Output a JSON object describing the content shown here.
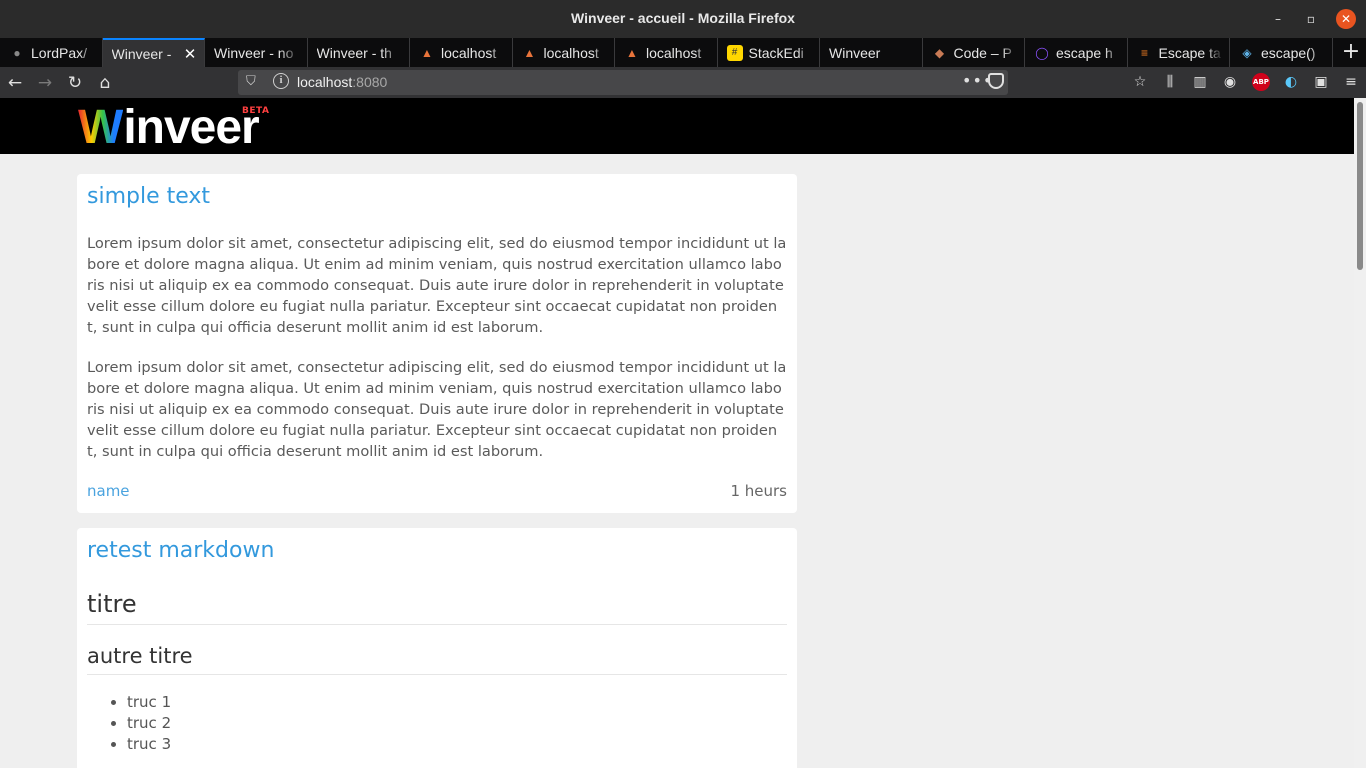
{
  "window": {
    "title": "Winveer - accueil - Mozilla Firefox",
    "minimize": "–",
    "maximize": "▫",
    "close": "✕"
  },
  "tabs": [
    {
      "label": "LordPax/",
      "icon": "github-icon",
      "active": false
    },
    {
      "label": "Winveer - ",
      "icon": "none",
      "active": true
    },
    {
      "label": "Winveer - no",
      "icon": "none",
      "active": false
    },
    {
      "label": "Winveer - th",
      "icon": "none",
      "active": false
    },
    {
      "label": "localhost",
      "icon": "vuepress-icon",
      "active": false
    },
    {
      "label": "localhost",
      "icon": "vuepress-icon",
      "active": false
    },
    {
      "label": "localhost",
      "icon": "vuepress-icon",
      "active": false
    },
    {
      "label": "StackEdi",
      "icon": "stackedit-icon",
      "active": false
    },
    {
      "label": "Winveer",
      "icon": "none",
      "active": false
    },
    {
      "label": "Code – P",
      "icon": "codepen-icon",
      "active": false
    },
    {
      "label": "escape h",
      "icon": "search-icon",
      "active": false
    },
    {
      "label": "Escape ta",
      "icon": "stackoverflow-icon",
      "active": false
    },
    {
      "label": "escape()",
      "icon": "docs-icon",
      "active": false
    }
  ],
  "navbar": {
    "url_host": "localhost",
    "url_port": ":8080",
    "more": "•••"
  },
  "site": {
    "logo_w": "W",
    "logo_rest": "inveer",
    "logo_beta": "BETA"
  },
  "posts": [
    {
      "title": "simple text",
      "paragraphs": [
        "Lorem ipsum dolor sit amet, consectetur adipiscing elit, sed do eiusmod tempor incididunt ut labore et dolore magna aliqua. Ut enim ad minim veniam, quis nostrud exercitation ullamco laboris nisi ut aliquip ex ea commodo consequat. Duis aute irure dolor in reprehenderit in voluptate velit esse cillum dolore eu fugiat nulla pariatur. Excepteur sint occaecat cupidatat non proident, sunt in culpa qui officia deserunt mollit anim id est laborum.",
        "Lorem ipsum dolor sit amet, consectetur adipiscing elit, sed do eiusmod tempor incididunt ut labore et dolore magna aliqua. Ut enim ad minim veniam, quis nostrud exercitation ullamco laboris nisi ut aliquip ex ea commodo consequat. Duis aute irure dolor in reprehenderit in voluptate velit esse cillum dolore eu fugiat nulla pariatur. Excepteur sint occaecat cupidatat non proident, sunt in culpa qui officia deserunt mollit anim id est laborum."
      ],
      "author": "name",
      "time": "1 heurs"
    },
    {
      "title": "retest markdown",
      "h1": "titre",
      "h2": "autre titre",
      "list": [
        "truc 1",
        "truc 2",
        "truc 3"
      ]
    }
  ],
  "colors": {
    "accent": "#3399dd",
    "tab_active_border": "#0a84ff",
    "close_button": "#e95420"
  }
}
